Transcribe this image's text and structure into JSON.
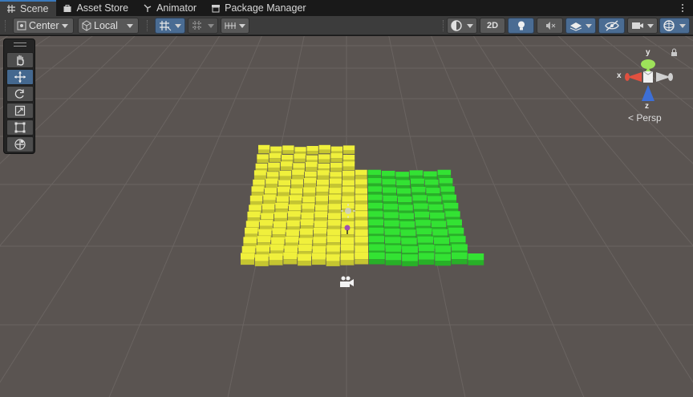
{
  "tabs": [
    {
      "label": "Scene",
      "icon": "grid-icon",
      "active": true
    },
    {
      "label": "Asset Store",
      "icon": "bag-icon",
      "active": false
    },
    {
      "label": "Animator",
      "icon": "animator-icon",
      "active": false
    },
    {
      "label": "Package Manager",
      "icon": "package-icon",
      "active": false
    }
  ],
  "toolbar": {
    "pivot_label": "Center",
    "space_label": "Local",
    "mode_2d_label": "2D"
  },
  "gizmo": {
    "x_label": "x",
    "y_label": "y",
    "z_label": "z",
    "projection_label": "Persp"
  },
  "colors": {
    "yellow_block": "#f0f03c",
    "green_block": "#33e233",
    "selected_button": "#4a6c93",
    "scene_background": "#5a5451"
  }
}
